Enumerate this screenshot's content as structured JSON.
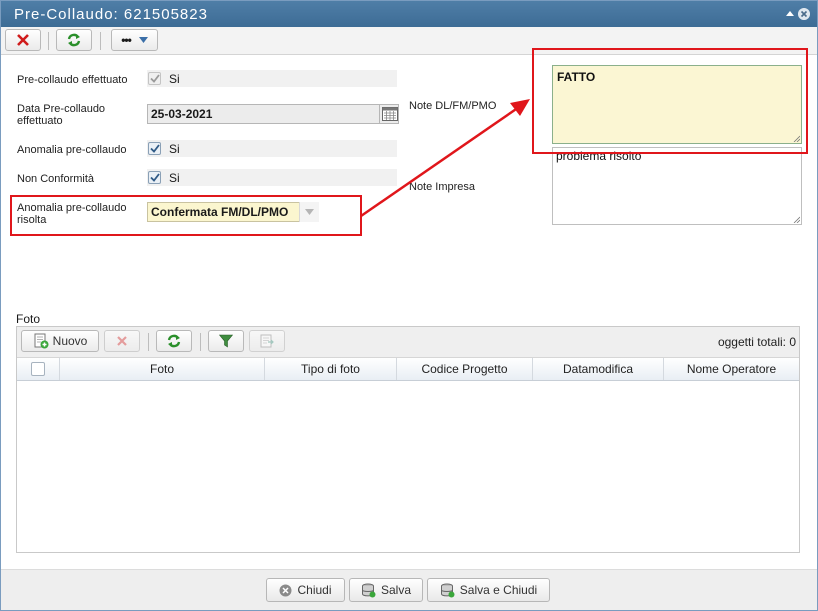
{
  "window": {
    "title": "Pre-Collaudo: 621505823"
  },
  "toolbar": {
    "close_icon": "x-icon",
    "refresh_icon": "refresh-icon",
    "more_icon": "more-icon"
  },
  "form": {
    "precollaudo_effettuato": {
      "label": "Pre-collaudo effettuato",
      "checked": true,
      "value": "Si"
    },
    "data_precollaudo": {
      "label_line1": "Data Pre-collaudo",
      "label_line2": "effettuato",
      "value": "25-03-2021"
    },
    "anomalia_precollaudo": {
      "label": "Anomalia pre-collaudo",
      "checked": true,
      "value": "Si"
    },
    "non_conformita": {
      "label": "Non Conformità",
      "checked": true,
      "value": "Si"
    },
    "anomalia_risolta": {
      "label_line1": "Anomalia pre-collaudo",
      "label_line2": "risolta",
      "value": "Confermata FM/DL/PMO"
    },
    "note_dl": {
      "label": "Note DL/FM/PMO",
      "value": "FATTO"
    },
    "note_impresa": {
      "label": "Note Impresa",
      "value": "problema risolto"
    }
  },
  "foto": {
    "title": "Foto",
    "nuovo_label": "Nuovo",
    "total_label": "oggetti totali: 0",
    "columns": [
      "Foto",
      "Tipo di foto",
      "Codice Progetto",
      "Datamodifica",
      "Nome Operatore"
    ]
  },
  "footer": {
    "chiudi": "Chiudi",
    "salva": "Salva",
    "salva_chiudi": "Salva e Chiudi"
  },
  "colors": {
    "title_bar": "#4577a2",
    "highlight": "#e0161b",
    "note_bg": "#fbf6d3"
  }
}
